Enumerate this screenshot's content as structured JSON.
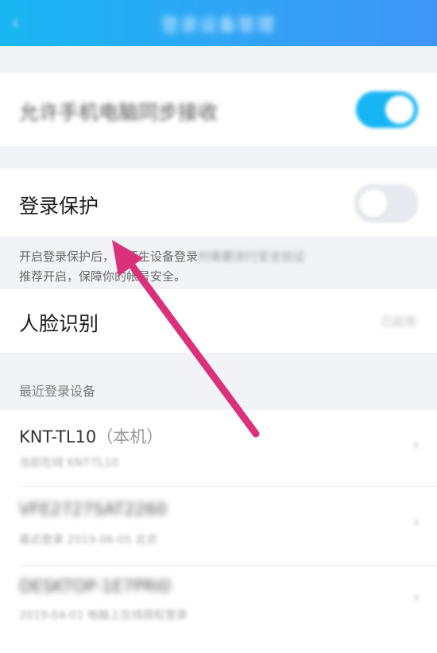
{
  "header": {
    "back_glyph": "‹",
    "title": "登录设备管理"
  },
  "sync_row": {
    "label": "允许手机电脑同步接收",
    "toggle_on": true
  },
  "login_protect": {
    "label": "登录保护",
    "toggle_on": false,
    "hint_visible": "开启登录保护后，在陌生设备登录",
    "hint_blurred": "时需要进行安全验证",
    "hint_line2": "推荐开启，保障你的帐号安全。"
  },
  "face": {
    "label": "人脸识别",
    "value": "已启用"
  },
  "recent": {
    "header": "最近登录设备",
    "devices": [
      {
        "name": "KNT-TL10",
        "suffix": "（本机）",
        "sub": "当前在线 KNT-TL10"
      },
      {
        "name": "VFE2727SAT2260",
        "sub": "最近登录 2019-06-05 北京"
      },
      {
        "name": "DESKTOP-1E7PRI0",
        "sub": "2019-04-01 电脑上在线授权登录"
      }
    ]
  },
  "icons": {
    "chevron": "›",
    "arrow_color": "#d9327a"
  }
}
